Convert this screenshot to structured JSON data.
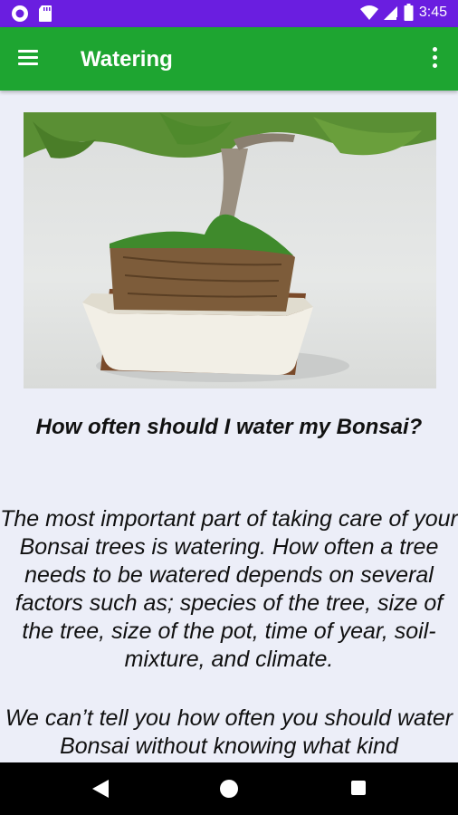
{
  "status_bar": {
    "time": "3:45",
    "icons": [
      "app-indicator-icon",
      "sd-card-icon",
      "wifi-icon",
      "signal-icon",
      "battery-icon"
    ]
  },
  "app_bar": {
    "title": "Watering",
    "menu_icon": "menu-icon",
    "overflow_icon": "more-vert-icon"
  },
  "article": {
    "question": "How often should I water my Bonsai?",
    "paragraph1": "The most important part of taking care of your Bonsai trees is watering. How often a tree needs to be watered depends on several factors such as; species of the tree, size of the tree, size of the pot, time of year, soil-mixture, and climate.",
    "paragraph2": "We can’t tell you how often you should water Bonsai without knowing what kind"
  },
  "nav_bar": {
    "icons": [
      "back-icon",
      "home-icon",
      "recents-icon"
    ]
  },
  "colors": {
    "status_bar": "#6a1ee0",
    "app_bar": "#1ea531",
    "background": "#eceef8"
  }
}
